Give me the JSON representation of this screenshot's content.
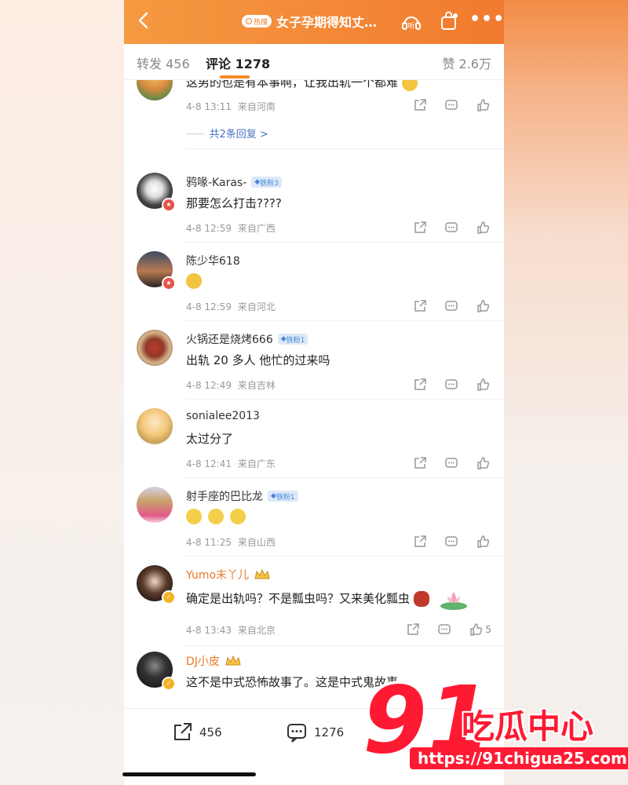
{
  "header": {
    "back_icon": "chevron-left-icon",
    "hot_badge": "热搜",
    "title": "女子孕期得知丈…",
    "listen_label": "听"
  },
  "tabs": {
    "repost": "转发 456",
    "comments": "评论 1278",
    "likes": "赞 2.6万"
  },
  "comments": [
    {
      "name": "",
      "text": "这男的也是有本事啊，让我出轨一个都难",
      "time": "4-8 13:11",
      "location": "来自河南",
      "replies": "共2条回复 >"
    },
    {
      "name": "鸦喙-Karas-",
      "badge": "铁粉3",
      "text": "那要怎么打击????",
      "time": "4-8 12:59",
      "location": "来自广西"
    },
    {
      "name": "陈少华618",
      "text": "",
      "time": "4-8 12:59",
      "location": "来自河北"
    },
    {
      "name": "火锅还是烧烤666",
      "badge": "铁粉1",
      "text": "出轨 20 多人 他忙的过来吗",
      "time": "4-8 12:49",
      "location": "来自吉林"
    },
    {
      "name": "sonialee2013",
      "text": "太过分了",
      "time": "4-8 12:41",
      "location": "来自广东"
    },
    {
      "name": "射手座的巴比龙",
      "badge": "铁粉1",
      "text": "",
      "time": "4-8 11:25",
      "location": "来自山西"
    },
    {
      "name": "Yumo末丫儿",
      "text": "确定是出轨吗？不是瓢虫吗？又来美化瓢虫",
      "time": "4-8 13:43",
      "location": "来自北京",
      "likes": "5"
    },
    {
      "name": "DJ小皮",
      "text": "这不是中式恐怖故事了。这是中式鬼故事。"
    }
  ],
  "bottom_bar": {
    "repost_count": "456",
    "comment_count": "1276"
  },
  "watermark": {
    "logo_text": "91",
    "cn_text": "吃瓜中心",
    "url": "https://91chigua25.com"
  },
  "colors": {
    "header_orange": "#f17a2e",
    "accent": "#f58a2a",
    "link_blue": "#4a72c4",
    "watermark_red": "#ff1a33"
  }
}
